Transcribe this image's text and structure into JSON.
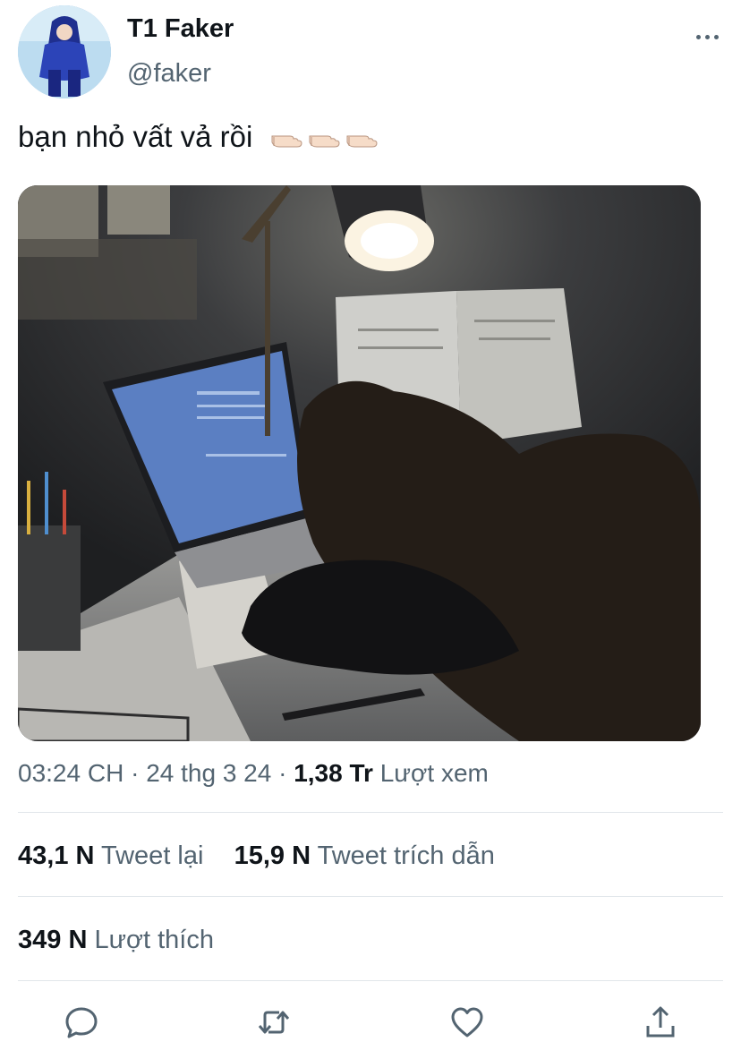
{
  "author": {
    "display_name": "T1 Faker",
    "handle": "@faker"
  },
  "tweet": {
    "text": "bạn nhỏ vất vả rồi",
    "emoji": [
      "pointing-hand-emoji",
      "pointing-hand-emoji",
      "pointing-hand-emoji"
    ],
    "image": "photo of person asleep at desk with laptop, lamp and open book"
  },
  "meta": {
    "time": "03:24 CH",
    "sep1": "·",
    "date": "24 thg 3 24",
    "sep2": "·",
    "views_count": "1,38 Tr",
    "views_label": "Lượt xem"
  },
  "stats": {
    "retweets_count": "43,1 N",
    "retweets_label": "Tweet lại",
    "quotes_count": "15,9 N",
    "quotes_label": "Tweet trích dẫn",
    "likes_count": "349 N",
    "likes_label": "Lượt thích"
  },
  "actions": [
    "reply-icon",
    "retweet-icon",
    "like-icon",
    "share-icon"
  ],
  "colors": {
    "primary_text": "#0f1419",
    "secondary_text": "#536471",
    "divider": "#e1e6ea"
  }
}
